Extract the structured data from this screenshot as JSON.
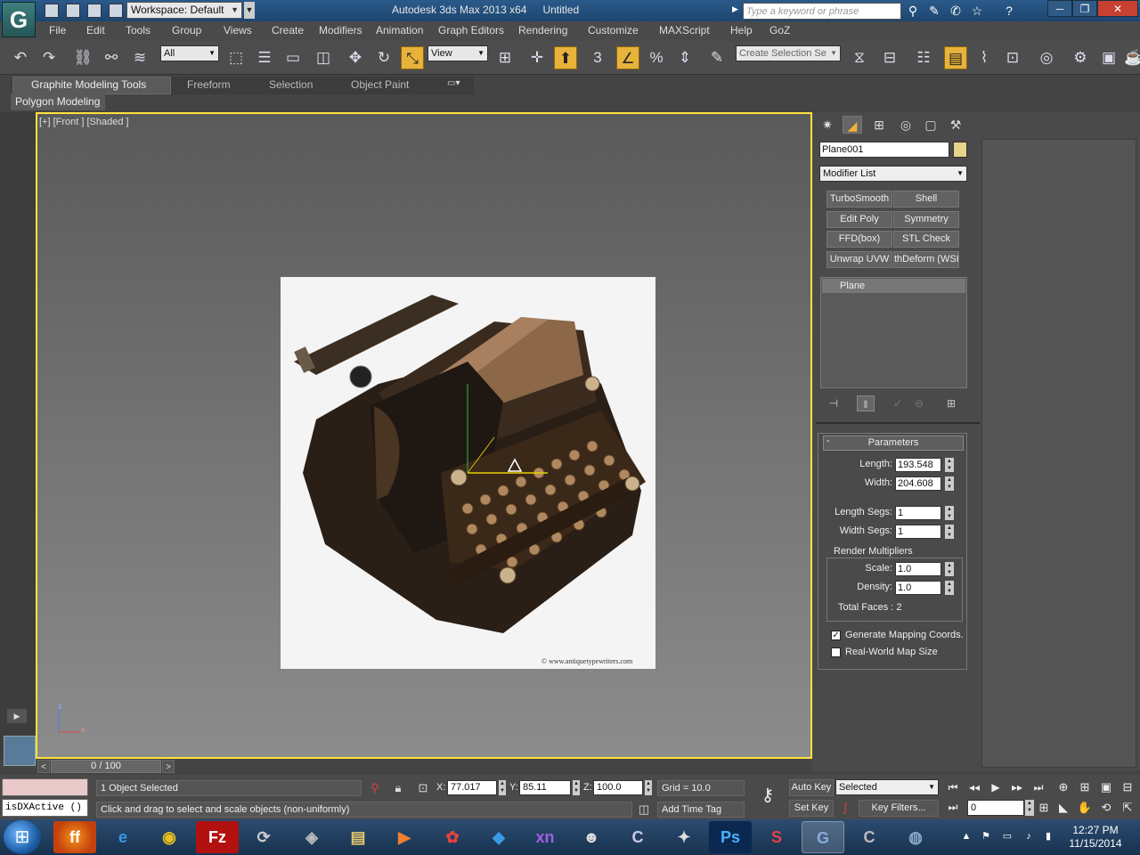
{
  "titlebar": {
    "workspace": "Workspace: Default",
    "app_name": "Autodesk 3ds Max  2013 x64",
    "document": "Untitled",
    "search_placeholder": "Type a keyword or phrase",
    "app_logo_letter": "G"
  },
  "menu": [
    "File",
    "Edit",
    "Tools",
    "Group",
    "Views",
    "Create",
    "Modifiers",
    "Animation",
    "Graph Editors",
    "Rendering",
    "Customize",
    "MAXScript",
    "Help",
    "GoZ"
  ],
  "toolbar": {
    "selection_filter": "All",
    "ref_coord": "View",
    "snap_number": "3",
    "named_selection_placeholder": "Create Selection Se"
  },
  "ribbon": {
    "tabs": [
      "Graphite Modeling Tools",
      "Freeform",
      "Selection",
      "Object Paint"
    ],
    "panel": "Polygon Modeling"
  },
  "viewport": {
    "label": "[+] [Front ] [Shaded ]",
    "image_watermark": "© www.antiquetypewriters.com",
    "axis_x": "x",
    "axis_z": "z"
  },
  "command_panel": {
    "object_name": "Plane001",
    "object_color": "#e6d48c",
    "modifier_list": "Modifier List",
    "modifier_buttons": [
      "TurboSmooth",
      "Shell",
      "Edit Poly",
      "Symmetry",
      "FFD(box)",
      "STL Check",
      "Unwrap UVW",
      "thDeform (WSI"
    ],
    "stack_item": "Plane",
    "parameters": {
      "title": "Parameters",
      "length_label": "Length:",
      "length": "193.548",
      "width_label": "Width:",
      "width": "204.608",
      "length_segs_label": "Length Segs:",
      "length_segs": "1",
      "width_segs_label": "Width Segs:",
      "width_segs": "1",
      "render_multipliers": "Render Multipliers",
      "scale_label": "Scale:",
      "scale": "1.0",
      "density_label": "Density:",
      "density": "1.0",
      "total_faces": "Total Faces : 2",
      "gen_mapping": "Generate Mapping Coords.",
      "gen_mapping_checked": true,
      "real_world": "Real-World Map Size",
      "real_world_checked": false
    }
  },
  "timeline": {
    "frame": "0 / 100"
  },
  "status": {
    "maxscript_output": "isDXActive ()",
    "selection": "1 Object Selected",
    "prompt": "Click and drag to select and scale objects (non-uniformly)",
    "x": "77.017",
    "y": "85.11",
    "z": "100.0",
    "grid": "Grid = 10.0",
    "add_time_tag": "Add Time Tag",
    "auto_key": "Auto Key",
    "set_key": "Set Key",
    "key_mode": "Selected",
    "key_filters": "Key Filters...",
    "current_frame": "0"
  },
  "taskbar": {
    "apps": [
      "firefox",
      "ie",
      "chrome",
      "filezilla",
      "app5",
      "app6",
      "explorer",
      "media",
      "app9",
      "dropbox",
      "xn",
      "app12",
      "app13",
      "app14",
      "photoshop",
      "substance",
      "3dsmax",
      "app18",
      "app19"
    ],
    "time": "12:27 PM",
    "date": "11/15/2014"
  }
}
